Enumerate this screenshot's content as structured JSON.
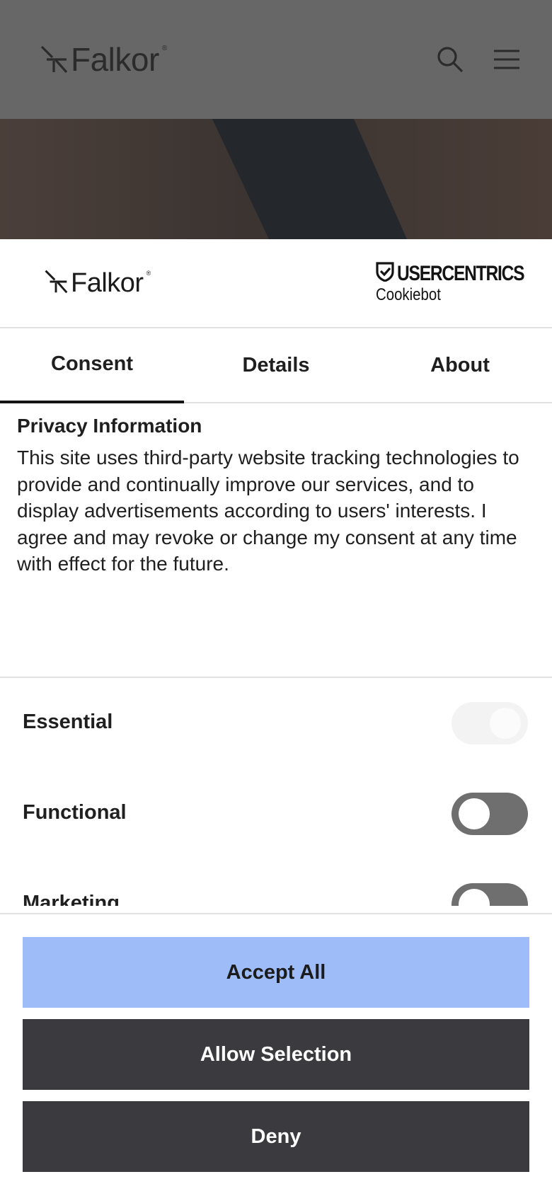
{
  "site": {
    "logo_text": "Falkor",
    "logo_mark": "®"
  },
  "dialog": {
    "brand_logo_text": "Falkor",
    "brand_logo_mark": "®",
    "provider_name": "USERCENTRICS",
    "provider_sub": "Cookiebot",
    "tabs": [
      {
        "label": "Consent",
        "active": true
      },
      {
        "label": "Details",
        "active": false
      },
      {
        "label": "About",
        "active": false
      }
    ],
    "privacy_title": "Privacy Information",
    "privacy_text": "This site uses third-party website tracking technologies to provide and continually improve our services, and to display advertisements according to users' interests. I agree and may revoke or change my consent at any time with effect for the future.",
    "categories": [
      {
        "label": "Essential",
        "state": "on-disabled"
      },
      {
        "label": "Functional",
        "state": "off"
      },
      {
        "label": "Marketing",
        "state": "off"
      }
    ],
    "buttons": {
      "accept_all": "Accept All",
      "allow_selection": "Allow Selection",
      "deny": "Deny"
    }
  },
  "colors": {
    "accept_bg": "#9dbcf8",
    "secondary_bg": "#3b3b3f",
    "toggle_off": "#6f6f6f",
    "header_overlay": "#676767"
  },
  "icons": [
    "falkor-mark-icon",
    "search-icon",
    "hamburger-menu-icon",
    "usercentrics-shield-icon"
  ]
}
